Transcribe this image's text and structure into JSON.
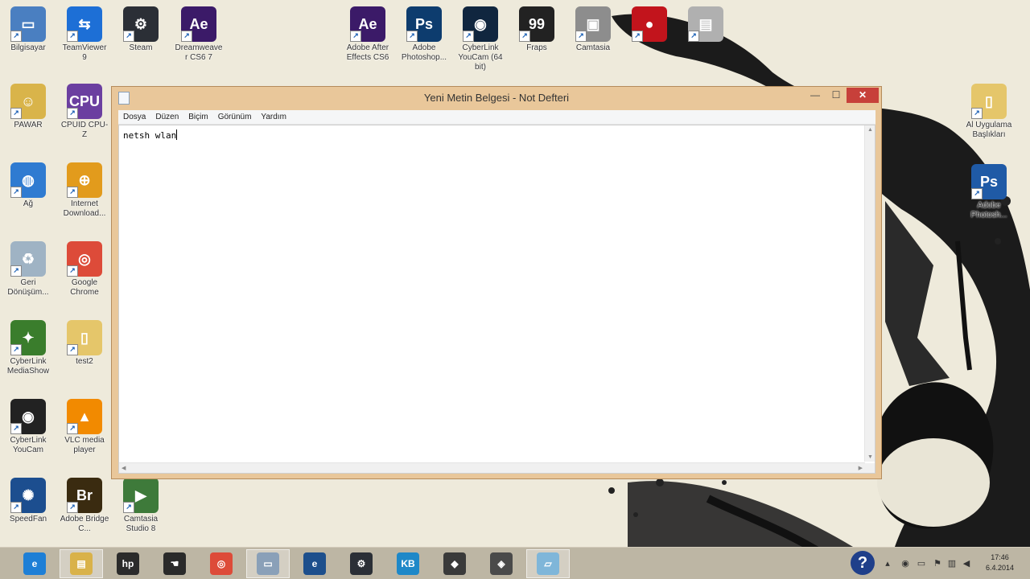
{
  "desktop": {
    "left_icons": [
      {
        "label": "Bilgisayar",
        "icon": "computer-icon",
        "color": "#4a7fc1",
        "glyph": "▭"
      },
      {
        "label": "TeamViewer 9",
        "icon": "teamviewer-icon",
        "color": "#1d6fd6",
        "glyph": "⇆"
      },
      {
        "label": "Steam",
        "icon": "steam-icon",
        "color": "#2b2f36",
        "glyph": "⚙"
      },
      {
        "label": "Dreamweaver CS6 7",
        "icon": "adobe-ae-icon",
        "color": "#3b1a68",
        "glyph": "Ae"
      },
      {
        "label": "Adobe After Effects CS6",
        "icon": "adobe-ae-icon",
        "color": "#3b1a68",
        "glyph": "Ae"
      },
      {
        "label": "Adobe Photoshop...",
        "icon": "adobe-ps-icon",
        "color": "#0d3c6e",
        "glyph": "Ps"
      },
      {
        "label": "CyberLink YouCam (64 bit)",
        "icon": "camera-lens-icon",
        "color": "#10263f",
        "glyph": "◉"
      },
      {
        "label": "Fraps",
        "icon": "fraps-icon",
        "color": "#222222",
        "glyph": "99"
      },
      {
        "label": "Camtasia",
        "icon": "camtasia-icon",
        "color": "#8d8d8d",
        "glyph": "▣"
      },
      {
        "label": "",
        "icon": "record-icon",
        "color": "#c2141c",
        "glyph": "●"
      },
      {
        "label": "",
        "icon": "video-converter-icon",
        "color": "#b0b0b0",
        "glyph": "▤"
      }
    ],
    "column_icons": [
      {
        "label": "PAWAR",
        "icon": "user-folder-icon",
        "color": "#d9b44a",
        "glyph": "☺"
      },
      {
        "label": "CPUID CPU-Z",
        "icon": "cpu-z-icon",
        "color": "#6b3fa0",
        "glyph": "CPU"
      },
      {
        "label": "Ağ",
        "icon": "network-icon",
        "color": "#2f7bd1",
        "glyph": "◍"
      },
      {
        "label": "Internet Download...",
        "icon": "globe-icon",
        "color": "#e29b1c",
        "glyph": "⊕"
      },
      {
        "label": "Geri Dönüşüm...",
        "icon": "recycle-bin-icon",
        "color": "#9fb3c4",
        "glyph": "♻"
      },
      {
        "label": "Google Chrome",
        "icon": "chrome-icon",
        "color": "#dd4b39",
        "glyph": "◎"
      },
      {
        "label": "CyberLink MediaShow",
        "icon": "mediashow-icon",
        "color": "#3a7d2c",
        "glyph": "✦"
      },
      {
        "label": "test2",
        "icon": "folder-icon",
        "color": "#e5c66a",
        "glyph": "▯"
      },
      {
        "label": "CyberLink YouCam",
        "icon": "youcam-icon",
        "color": "#222222",
        "glyph": "◉"
      },
      {
        "label": "VLC media player",
        "icon": "vlc-icon",
        "color": "#f28a00",
        "glyph": "▲"
      },
      {
        "label": "SpeedFan",
        "icon": "speedfan-icon",
        "color": "#1c4e8f",
        "glyph": "✺"
      },
      {
        "label": "Adobe Bridge C...",
        "icon": "adobe-br-icon",
        "color": "#3a2b10",
        "glyph": "Br"
      },
      {
        "label": "Camtasia Studio 8",
        "icon": "camtasia-studio-icon",
        "color": "#3e7a3a",
        "glyph": "▶"
      }
    ],
    "right_icons": [
      {
        "label": "Al Uygulama Başlıkları",
        "icon": "folder-icon",
        "color": "#e5c66a",
        "glyph": "▯"
      },
      {
        "label": "Adobe Photosh...",
        "icon": "adobe-ps-icon",
        "color": "#1f5aa6",
        "glyph": "Ps"
      }
    ]
  },
  "notepad": {
    "title": "Yeni Metin Belgesi - Not Defteri",
    "menu": [
      "Dosya",
      "Düzen",
      "Biçim",
      "Görünüm",
      "Yardım"
    ],
    "content": "netsh wlan",
    "controls": {
      "minimize": "—",
      "maximize": "☐",
      "close": "✕"
    }
  },
  "taskbar": {
    "items": [
      {
        "icon": "internet-explorer-icon",
        "color": "#1e7fd6",
        "glyph": "e",
        "active": false
      },
      {
        "icon": "file-explorer-icon",
        "color": "#d9b24a",
        "glyph": "▤",
        "active": true
      },
      {
        "icon": "hp-icon",
        "color": "#2b2b2b",
        "glyph": "hp",
        "active": false
      },
      {
        "icon": "media-icon",
        "color": "#2a2a2a",
        "glyph": "☚",
        "active": false
      },
      {
        "icon": "chrome-icon",
        "color": "#dd4b39",
        "glyph": "◎",
        "active": false
      },
      {
        "icon": "network-icon",
        "color": "#8aa0b8",
        "glyph": "▭",
        "active": true
      },
      {
        "icon": "app-e-icon",
        "color": "#1d4f8c",
        "glyph": "e",
        "active": false
      },
      {
        "icon": "steam-icon",
        "color": "#2b2f36",
        "glyph": "⚙",
        "active": false
      },
      {
        "icon": "notes-icon",
        "color": "#1e88c8",
        "glyph": "KB",
        "active": false
      },
      {
        "icon": "tool-icon",
        "color": "#3a3a3a",
        "glyph": "◆",
        "active": false
      },
      {
        "icon": "security-icon",
        "color": "#4a4a4a",
        "glyph": "◈",
        "active": false
      },
      {
        "icon": "notepad-icon",
        "color": "#7fb6d9",
        "glyph": "▱",
        "active": true
      }
    ],
    "clock": {
      "time": "17:46",
      "date": "6.4.2014"
    }
  }
}
